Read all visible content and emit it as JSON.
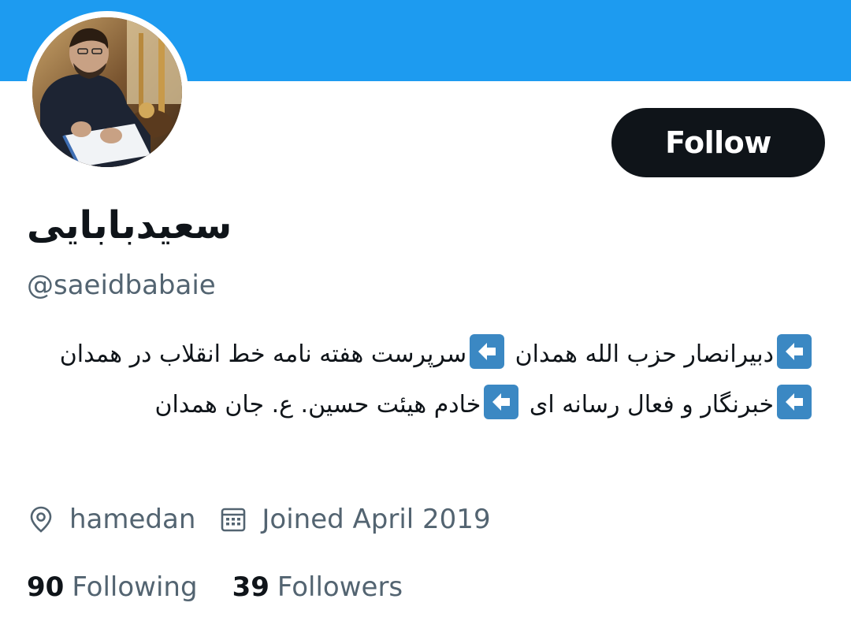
{
  "colors": {
    "banner": "#1d9bf0",
    "button_bg": "#0f1419",
    "button_text": "#ffffff",
    "secondary_text": "#536471",
    "arrow_badge": "#3b88c3"
  },
  "profile": {
    "display_name": "سعیدبابایی",
    "handle": "@saeidbabaie",
    "follow_label": "Follow",
    "avatar_icon": "profile-photo"
  },
  "bio": {
    "segments": [
      "دبیرانصار حزب الله همدان",
      "سرپرست هفته نامه خط انقلاب در همدان",
      "خبرنگار و فعال رسانه ای",
      "خادم هیئت حسین. ع. جان همدان"
    ],
    "arrow_icon": "left-arrow-emoji"
  },
  "meta": {
    "location": "hamedan",
    "location_icon": "location-pin-icon",
    "joined": "Joined April 2019",
    "joined_icon": "calendar-icon"
  },
  "stats": {
    "following_count": "90",
    "following_label": "Following",
    "followers_count": "39",
    "followers_label": "Followers"
  }
}
